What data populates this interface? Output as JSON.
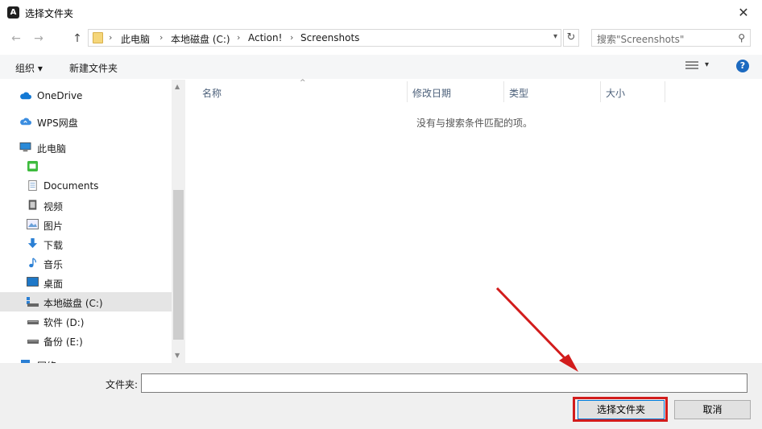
{
  "window": {
    "title": "选择文件夹",
    "close_glyph": "✕",
    "app_icon_letter": "A"
  },
  "nav": {
    "back": "←",
    "forward": "→",
    "up": "↑"
  },
  "address": {
    "chevron": "›",
    "crumbs": [
      "此电脑",
      "本地磁盘 (C:)",
      "Action!",
      "Screenshots"
    ]
  },
  "search": {
    "placeholder": "搜索\"Screenshots\""
  },
  "toolbar": {
    "organize": "组织 ▾",
    "new_folder": "新建文件夹",
    "help": "?"
  },
  "sidebar": {
    "items": [
      {
        "label": "OneDrive",
        "icon": "cloud-icon"
      },
      {
        "label": "WPS网盘",
        "icon": "wps-cloud-icon"
      },
      {
        "label": "此电脑",
        "icon": "computer-icon"
      },
      {
        "label": "",
        "icon": "green-app-icon"
      },
      {
        "label": "Documents",
        "icon": "document-icon"
      },
      {
        "label": "视频",
        "icon": "video-icon"
      },
      {
        "label": "图片",
        "icon": "picture-icon"
      },
      {
        "label": "下载",
        "icon": "download-icon"
      },
      {
        "label": "音乐",
        "icon": "music-icon"
      },
      {
        "label": "桌面",
        "icon": "desktop-icon"
      },
      {
        "label": "本地磁盘 (C:)",
        "icon": "drive-icon",
        "selected": true
      },
      {
        "label": "软件 (D:)",
        "icon": "drive-icon"
      },
      {
        "label": "备份 (E:)",
        "icon": "drive-icon"
      },
      {
        "label": "网络",
        "icon": "network-icon"
      }
    ]
  },
  "columns": [
    "名称",
    "修改日期",
    "类型",
    "大小"
  ],
  "empty_message": "没有与搜索条件匹配的项。",
  "bottom": {
    "folder_label": "文件夹:",
    "folder_value": "",
    "select_button": "选择文件夹",
    "cancel_button": "取消"
  },
  "colors": {
    "highlight": "#d21c1c",
    "accent": "#0078d7"
  }
}
